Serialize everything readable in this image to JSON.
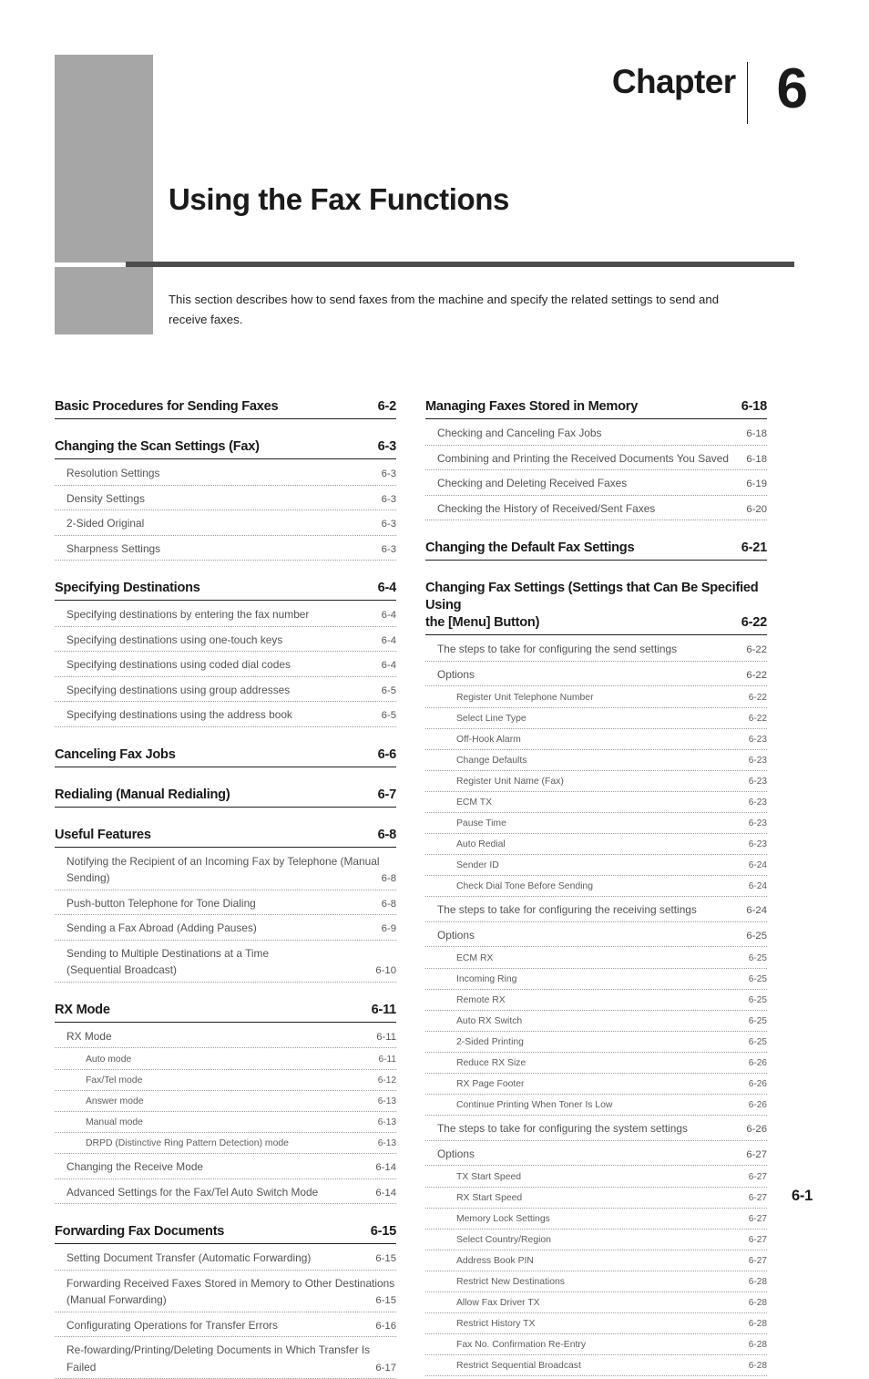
{
  "chapter": {
    "word": "Chapter",
    "number": "6",
    "title": "Using the Fax Functions",
    "intro": "This section describes how to send faxes from the machine and specify the related settings to send and receive faxes."
  },
  "footer": {
    "folio": "6-1"
  },
  "toc": {
    "left": [
      {
        "level": 1,
        "label": "Basic Procedures for Sending Faxes",
        "page": "6-2"
      },
      {
        "level": 1,
        "label": "Changing the Scan Settings (Fax)",
        "page": "6-3"
      },
      {
        "level": 2,
        "label": "Resolution Settings",
        "page": "6-3"
      },
      {
        "level": 2,
        "label": "Density Settings",
        "page": "6-3"
      },
      {
        "level": 2,
        "label": "2-Sided Original",
        "page": "6-3"
      },
      {
        "level": 2,
        "label": "Sharpness Settings",
        "page": "6-3"
      },
      {
        "level": 1,
        "label": "Specifying Destinations",
        "page": "6-4"
      },
      {
        "level": 2,
        "label": "Specifying destinations by entering the fax number",
        "page": "6-4"
      },
      {
        "level": 2,
        "label": "Specifying destinations using one-touch keys",
        "page": "6-4"
      },
      {
        "level": 2,
        "label": "Specifying destinations using coded dial codes",
        "page": "6-4"
      },
      {
        "level": 2,
        "label": "Specifying destinations using group addresses",
        "page": "6-5"
      },
      {
        "level": 2,
        "label": "Specifying destinations using the address book",
        "page": "6-5"
      },
      {
        "level": 1,
        "label": "Canceling Fax Jobs",
        "page": "6-6"
      },
      {
        "level": 1,
        "label": "Redialing (Manual Redialing)",
        "page": "6-7"
      },
      {
        "level": 1,
        "label": "Useful Features",
        "page": "6-8"
      },
      {
        "level": 2,
        "label": "Notifying the Recipient of an Incoming Fax by Telephone (Manual",
        "label2": "Sending)",
        "page": "6-8"
      },
      {
        "level": 2,
        "label": "Push-button Telephone for Tone Dialing",
        "page": "6-8"
      },
      {
        "level": 2,
        "label": "Sending a Fax Abroad (Adding Pauses)",
        "page": "6-9"
      },
      {
        "level": 2,
        "label": "Sending to Multiple Destinations at a Time",
        "label2": "(Sequential Broadcast)",
        "page": "6-10"
      },
      {
        "level": 1,
        "label": "RX Mode",
        "page": "6-11"
      },
      {
        "level": 2,
        "label": "RX Mode",
        "page": "6-11"
      },
      {
        "level": 3,
        "label": "Auto mode",
        "page": "6-11"
      },
      {
        "level": 3,
        "label": "Fax/Tel mode",
        "page": "6-12"
      },
      {
        "level": 3,
        "label": "Answer mode",
        "page": "6-13"
      },
      {
        "level": 3,
        "label": "Manual mode",
        "page": "6-13"
      },
      {
        "level": 3,
        "label": "DRPD (Distinctive Ring Pattern Detection) mode",
        "page": "6-13"
      },
      {
        "level": 2,
        "label": "Changing the Receive Mode",
        "page": "6-14"
      },
      {
        "level": 2,
        "label": "Advanced Settings for the Fax/Tel Auto Switch Mode",
        "page": "6-14"
      },
      {
        "level": 1,
        "label": "Forwarding Fax Documents",
        "page": "6-15"
      },
      {
        "level": 2,
        "label": "Setting Document Transfer (Automatic Forwarding)",
        "page": "6-15"
      },
      {
        "level": 2,
        "label": "Forwarding Received Faxes Stored in Memory to Other Destinations",
        "label2": "(Manual Forwarding)",
        "page": "6-15"
      },
      {
        "level": 2,
        "label": "Configurating Operations for Transfer Errors",
        "page": "6-16"
      },
      {
        "level": 2,
        "label": "Re-fowarding/Printing/Deleting Documents in Which Transfer Is",
        "label2": "Failed",
        "page": "6-17"
      }
    ],
    "right": [
      {
        "level": 1,
        "label": "Managing Faxes Stored in Memory",
        "page": "6-18"
      },
      {
        "level": 2,
        "label": "Checking and Canceling Fax Jobs",
        "page": "6-18"
      },
      {
        "level": 2,
        "label": "Combining and Printing the Received Documents You Saved",
        "page": "6-18"
      },
      {
        "level": 2,
        "label": "Checking and Deleting Received Faxes",
        "page": "6-19"
      },
      {
        "level": 2,
        "label": "Checking the History of Received/Sent Faxes",
        "page": "6-20"
      },
      {
        "level": 1,
        "label": "Changing the Default Fax Settings",
        "page": "6-21"
      },
      {
        "level": 1,
        "label": "Changing Fax Settings (Settings that Can Be Specified Using",
        "label2": "the [Menu] Button)",
        "page": "6-22"
      },
      {
        "level": 2,
        "label": "The steps to take for configuring the send settings",
        "page": "6-22"
      },
      {
        "level": 2,
        "label": "Options",
        "page": "6-22"
      },
      {
        "level": 3,
        "label": "Register Unit Telephone Number",
        "page": "6-22"
      },
      {
        "level": 3,
        "label": "Select Line Type",
        "page": "6-22"
      },
      {
        "level": 3,
        "label": "Off-Hook Alarm",
        "page": "6-23"
      },
      {
        "level": 3,
        "label": "Change Defaults",
        "page": "6-23"
      },
      {
        "level": 3,
        "label": "Register Unit Name (Fax)",
        "page": "6-23"
      },
      {
        "level": 3,
        "label": "ECM TX",
        "page": "6-23"
      },
      {
        "level": 3,
        "label": "Pause Time",
        "page": "6-23"
      },
      {
        "level": 3,
        "label": "Auto Redial",
        "page": "6-23"
      },
      {
        "level": 3,
        "label": "Sender ID",
        "page": "6-24"
      },
      {
        "level": 3,
        "label": "Check Dial Tone Before Sending",
        "page": "6-24"
      },
      {
        "level": 2,
        "label": "The steps to take for configuring the receiving settings",
        "page": "6-24"
      },
      {
        "level": 2,
        "label": "Options",
        "page": "6-25"
      },
      {
        "level": 3,
        "label": "ECM RX",
        "page": "6-25"
      },
      {
        "level": 3,
        "label": "Incoming Ring",
        "page": "6-25"
      },
      {
        "level": 3,
        "label": "Remote RX",
        "page": "6-25"
      },
      {
        "level": 3,
        "label": "Auto RX Switch",
        "page": "6-25"
      },
      {
        "level": 3,
        "label": "2-Sided Printing",
        "page": "6-25"
      },
      {
        "level": 3,
        "label": "Reduce RX Size",
        "page": "6-26"
      },
      {
        "level": 3,
        "label": "RX Page Footer",
        "page": "6-26"
      },
      {
        "level": 3,
        "label": "Continue Printing When Toner Is Low",
        "page": "6-26"
      },
      {
        "level": 2,
        "label": "The steps to take for configuring the system settings",
        "page": "6-26"
      },
      {
        "level": 2,
        "label": "Options",
        "page": "6-27"
      },
      {
        "level": 3,
        "label": "TX Start Speed",
        "page": "6-27"
      },
      {
        "level": 3,
        "label": "RX Start Speed",
        "page": "6-27"
      },
      {
        "level": 3,
        "label": "Memory Lock Settings",
        "page": "6-27"
      },
      {
        "level": 3,
        "label": "Select Country/Region",
        "page": "6-27"
      },
      {
        "level": 3,
        "label": "Address Book PIN",
        "page": "6-27"
      },
      {
        "level": 3,
        "label": "Restrict New Destinations",
        "page": "6-28"
      },
      {
        "level": 3,
        "label": "Allow Fax Driver TX",
        "page": "6-28"
      },
      {
        "level": 3,
        "label": "Restrict History TX",
        "page": "6-28"
      },
      {
        "level": 3,
        "label": "Fax No. Confirmation Re-Entry",
        "page": "6-28"
      },
      {
        "level": 3,
        "label": "Restrict Sequential Broadcast",
        "page": "6-28"
      }
    ]
  }
}
